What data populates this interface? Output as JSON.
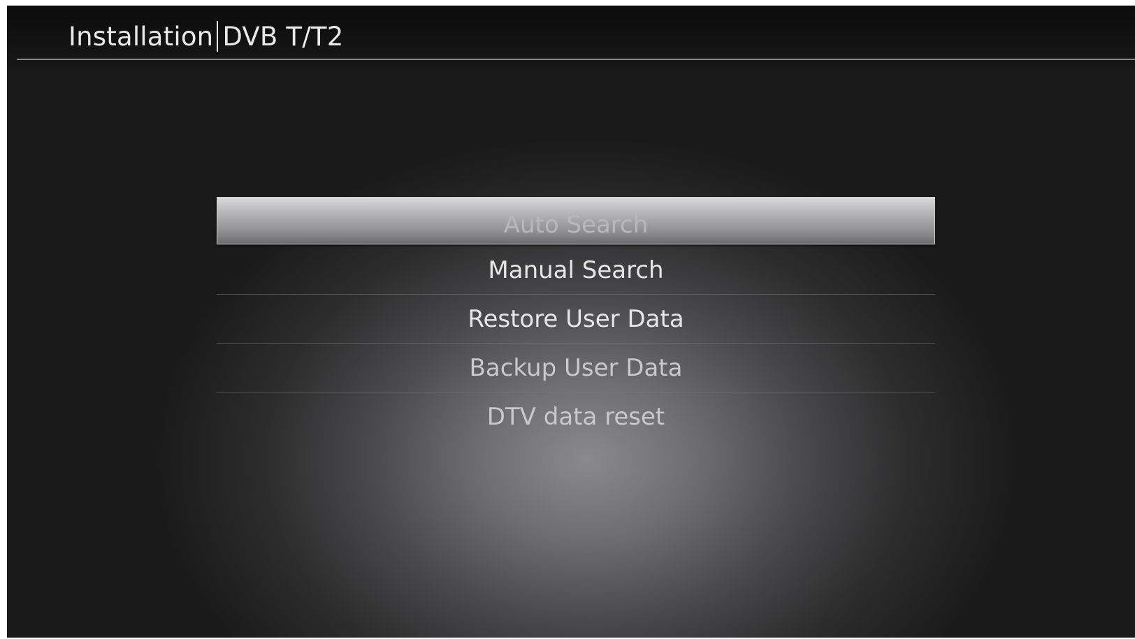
{
  "header": {
    "section": "Installation",
    "subsection": "DVB T/T2"
  },
  "menu": {
    "items": [
      {
        "label": "Auto Search",
        "selected": true
      },
      {
        "label": "Manual Search",
        "selected": false
      },
      {
        "label": "Restore User Data",
        "selected": false
      },
      {
        "label": "Backup User Data",
        "selected": false
      },
      {
        "label": "DTV data reset",
        "selected": false
      }
    ]
  },
  "colors": {
    "text": "#e6e6e6",
    "selection_highlight": "#b4b4b6",
    "background": "#151515"
  }
}
